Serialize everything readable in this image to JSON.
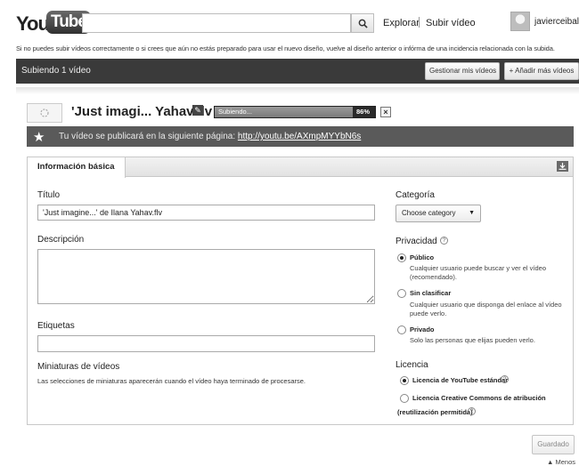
{
  "header": {
    "logo_you": "You",
    "logo_tube": "Tube",
    "search_value": "",
    "search_icon": "magnifier-icon",
    "nav_explore": "Explorar",
    "nav_upload": "Subir vídeo",
    "username": "javierceibal"
  },
  "notice": "Si no puedes subir vídeos correctamente o si crees que aún no estás preparado para usar el nuevo diseño, vuelve al diseño anterior o infórma de una incidencia relacionada con la subida.",
  "upload_bar": {
    "title": "Subiendo 1 vídeo",
    "manage_label": "Gestionar mis vídeos",
    "add_label": "+ Añadir más vídeos"
  },
  "video": {
    "title": "'Just imagi... Yahav.flv",
    "status": "Subiendo...",
    "progress_percent": 86,
    "progress_text": "86%",
    "cancel_label": "×"
  },
  "url_bar": {
    "text": "Tu vídeo se publicará en la siguiente página:",
    "url": "http://youtu.be/AXmpMYYbN6s"
  },
  "form": {
    "tab_basic": "Información básica",
    "title_label": "Título",
    "title_value": "'Just imagine...' de Ilana Yahav.flv",
    "description_label": "Descripción",
    "description_value": "",
    "tags_label": "Etiquetas",
    "tags_value": "",
    "thumbs_label": "Miniaturas de vídeos",
    "thumbs_text": "Las selecciones de miniaturas aparecerán cuando el vídeo haya terminado de procesarse.",
    "category_label": "Categoría",
    "category_value": "Choose category",
    "privacy_label": "Privacidad",
    "privacy_options": [
      {
        "label": "Público",
        "desc": "Cualquier usuario puede buscar y ver el vídeo (recomendado).",
        "checked": true
      },
      {
        "label": "Sin clasificar",
        "desc": "Cualquier usuario que disponga del enlace al vídeo puede verlo.",
        "checked": false
      },
      {
        "label": "Privado",
        "desc": "Solo las personas que elijas pueden verlo.",
        "checked": false
      }
    ],
    "license_label": "Licencia",
    "license_options": [
      {
        "label": "Licencia de YouTube estándar",
        "checked": true
      },
      {
        "label": "Licencia Creative Commons de atribución",
        "label2": "(reutilización permitida)",
        "checked": false
      }
    ]
  },
  "footer": {
    "save_label": "Guardado",
    "less_label": "▲ Menos"
  }
}
